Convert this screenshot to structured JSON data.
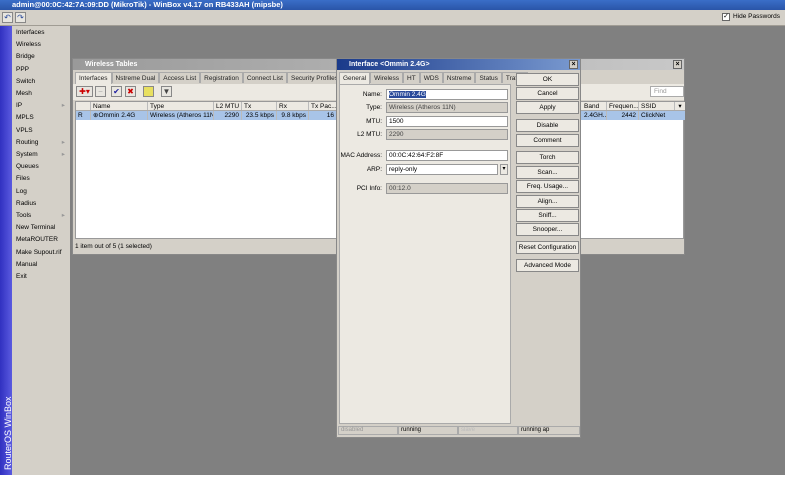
{
  "title": "admin@00:0C:42:7A:09:DD (MikroTik) - WinBox v4.17 on RB433AH (mipsbe)",
  "toolbar": {
    "undo_icon": "undo-icon",
    "redo_icon": "redo-icon",
    "hide_passwords_label": "Hide Passwords",
    "hide_passwords_checked": true
  },
  "brand": "RouterOS WinBox",
  "sidebar": [
    "Interfaces",
    "Wireless",
    "Bridge",
    "PPP",
    "Switch",
    "Mesh",
    "IP",
    "MPLS",
    "VPLS",
    "Routing",
    "System",
    "Queues",
    "Files",
    "Log",
    "Radius",
    "Tools",
    "New Terminal",
    "MetaROUTER",
    "Make Supout.rif",
    "Manual",
    "Exit"
  ],
  "sidebar_submenu": [
    "IP",
    "Routing",
    "System",
    "Tools"
  ],
  "wireless_tables": {
    "title": "Wireless Tables",
    "tabs": [
      "Interfaces",
      "Nstreme Dual",
      "Access List",
      "Registration",
      "Connect List",
      "Security Profiles"
    ],
    "find_placeholder": "Find",
    "columns": [
      "",
      "Name",
      "Type",
      "L2 MTU",
      "Tx",
      "Rx",
      "Tx Pac..."
    ],
    "columns_right": [
      "Band",
      "Frequen...",
      "SSID"
    ],
    "row": {
      "flag": "R",
      "name": "Ommin 2.4G",
      "type": "Wireless (Atheros 11N)",
      "l2mtu": "2290",
      "tx": "23.5 kbps",
      "rx": "9.8 kbps",
      "txpac": "16",
      "band": "2.4GH...",
      "freq": "2442",
      "ssid": "ClickNet"
    },
    "status": "1 item out of 5 (1 selected)"
  },
  "dialog": {
    "title": "Interface <Ommin 2.4G>",
    "tabs": [
      "General",
      "Wireless",
      "HT",
      "WDS",
      "Nstreme",
      "Status",
      "Traffic"
    ],
    "fields": {
      "name_label": "Name:",
      "name": "Ommin 2.4G",
      "type_label": "Type:",
      "type": "Wireless (Atheros 11N)",
      "mtu_label": "MTU:",
      "mtu": "1500",
      "l2mtu_label": "L2 MTU:",
      "l2mtu": "2290",
      "mac_label": "MAC Address:",
      "mac": "00:0C:42:64:F2:8F",
      "arp_label": "ARP:",
      "arp": "reply-only",
      "pci_label": "PCI Info:",
      "pci": "00:12.0"
    },
    "buttons": [
      "OK",
      "Cancel",
      "Apply",
      "Disable",
      "Comment",
      "Torch",
      "Scan...",
      "Freq. Usage...",
      "Align...",
      "Sniff...",
      "Snooper...",
      "Reset Configuration",
      "Advanced Mode"
    ],
    "status": [
      "disabled",
      "running",
      "slave",
      "running ap"
    ]
  },
  "colors": {
    "titlebar": "#2a55a8",
    "desktop": "#808080",
    "selected_row": "#a8c4e8",
    "brand": "#3a3ad0"
  }
}
